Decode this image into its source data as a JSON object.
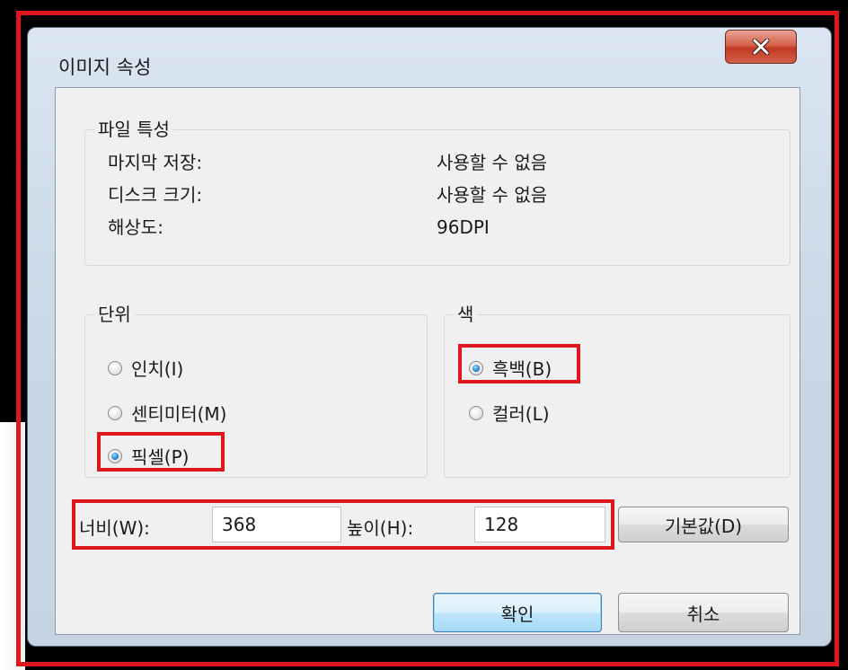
{
  "window": {
    "title": "이미지 속성"
  },
  "file_properties": {
    "group_title": "파일 특성",
    "rows": [
      {
        "label": "마지막 저장:",
        "value": "사용할 수 없음"
      },
      {
        "label": "디스크 크기:",
        "value": "사용할 수 없음"
      },
      {
        "label": "해상도:",
        "value": "96DPI"
      }
    ]
  },
  "units": {
    "group_title": "단위",
    "options": [
      "인치(I)",
      "센티미터(M)",
      "픽셀(P)"
    ],
    "selected": "픽셀(P)"
  },
  "color": {
    "group_title": "색",
    "options": [
      "흑백(B)",
      "컬러(L)"
    ],
    "selected": "흑백(B)"
  },
  "size": {
    "width_label": "너비(W):",
    "width_value": "368",
    "height_label": "높이(H):",
    "height_value": "128",
    "default_button": "기본값(D)"
  },
  "buttons": {
    "ok": "확인",
    "cancel": "취소"
  },
  "colors": {
    "highlight": "#e0161f",
    "close_button": "#c13a22"
  },
  "icons": {
    "close": "close-icon"
  }
}
